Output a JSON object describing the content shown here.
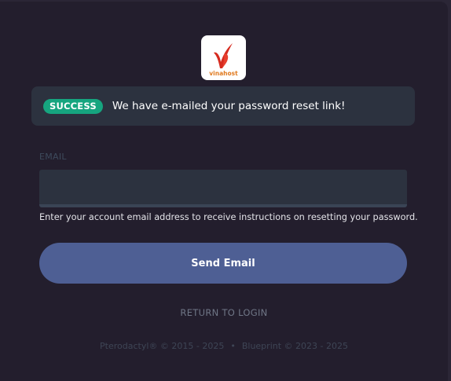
{
  "logo": {
    "brand_text": "vinahost"
  },
  "alert": {
    "badge": "SUCCESS",
    "message": "We have e-mailed your password reset link!"
  },
  "form": {
    "email_label": "EMAIL",
    "email_value": "",
    "help_text": "Enter your account email address to receive instructions on resetting your password.",
    "submit_label": "Send Email",
    "return_link": "RETURN TO LOGIN"
  },
  "footer": {
    "pterodactyl": "Pterodactyl® © 2015 - 2025",
    "separator": "•",
    "blueprint": "Blueprint © 2023 - 2025"
  },
  "colors": {
    "background": "#231e2d",
    "alert_bg": "#2c323f",
    "success_badge": "#16a57f",
    "primary_button": "#4e5f94"
  }
}
